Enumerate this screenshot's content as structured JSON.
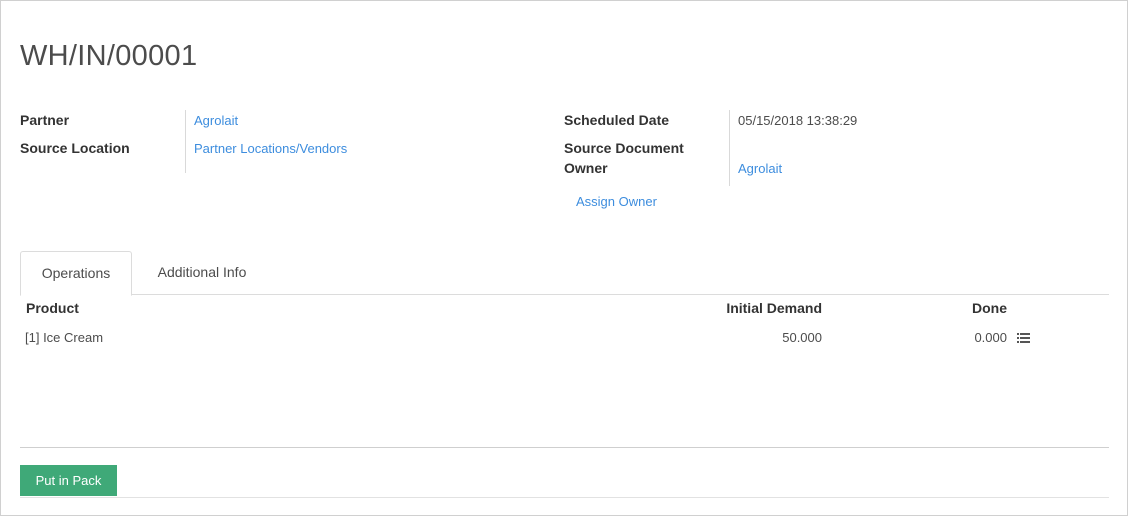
{
  "record": {
    "title": "WH/IN/00001"
  },
  "fields_left": {
    "partner_label": "Partner",
    "partner_value": "Agrolait",
    "source_location_label": "Source Location",
    "source_location_value": "Partner Locations/Vendors"
  },
  "fields_right": {
    "scheduled_date_label": "Scheduled Date",
    "scheduled_date_value": "05/15/2018 13:38:29",
    "source_document_label": "Source Document",
    "owner_label": "Owner",
    "owner_value": "Agrolait",
    "assign_owner_label": "Assign Owner"
  },
  "tabs": [
    {
      "label": "Operations",
      "active": true
    },
    {
      "label": "Additional Info",
      "active": false
    }
  ],
  "operations_table": {
    "columns": [
      "Product",
      "Initial Demand",
      "Done"
    ],
    "rows": [
      {
        "product": "[1] Ice Cream",
        "initial_demand": "50.000",
        "done": "0.000"
      }
    ]
  },
  "actions": {
    "put_in_pack_label": "Put in Pack"
  },
  "colors": {
    "link": "#3d8dde",
    "primary_button": "#3fa978"
  },
  "icons": {
    "detailed_operations": "list-icon"
  }
}
